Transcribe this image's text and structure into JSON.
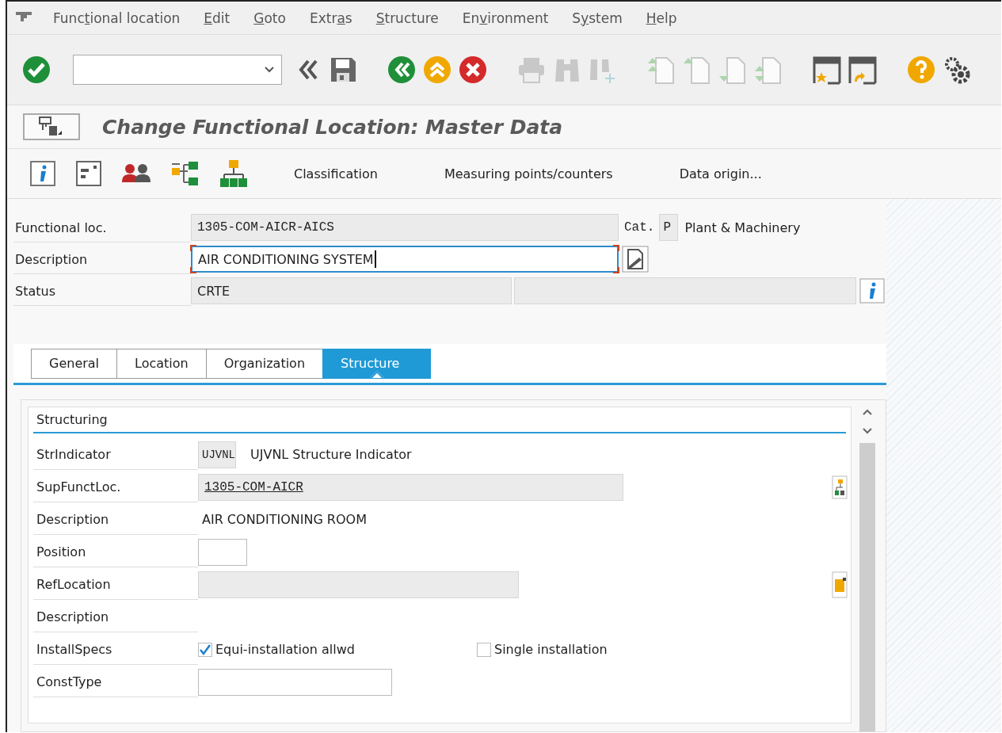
{
  "menu_bar": {
    "items": [
      {
        "before": "Func",
        "mnemonic": "t",
        "after": "ional location"
      },
      {
        "mnemonic": "E",
        "after": "dit"
      },
      {
        "mnemonic": "G",
        "after": "oto"
      },
      {
        "before": "Extr",
        "mnemonic": "a",
        "after": "s"
      },
      {
        "mnemonic": "S",
        "after": "tructure"
      },
      {
        "before": "En",
        "mnemonic": "v",
        "after": "ironment"
      },
      {
        "before": "S",
        "mnemonic": "y",
        "after": "stem"
      },
      {
        "mnemonic": "H",
        "after": "elp"
      }
    ]
  },
  "toolbar": {
    "buttons": [
      {
        "disabled": false
      },
      {
        "disabled": false
      },
      {
        "disabled": false
      },
      {
        "disabled": false
      },
      {
        "disabled": false
      },
      {
        "disabled": false
      },
      {
        "disabled": true
      },
      {
        "disabled": true
      },
      {
        "disabled": true
      },
      {
        "disabled": true
      },
      {
        "disabled": true
      },
      {
        "disabled": true
      },
      {
        "disabled": true
      },
      {
        "disabled": false
      },
      {
        "disabled": false
      },
      {
        "disabled": false
      },
      {
        "disabled": false
      }
    ]
  },
  "title": "Change Functional Location: Master Data",
  "app_toolbar": {
    "text_buttons": [
      "Classification",
      "Measuring points/counters",
      "Data origin..."
    ]
  },
  "header": {
    "rows": [
      {
        "kind": "location",
        "label": "Functional loc.",
        "value": "1305-COM-AICR-AICS",
        "category_label": "Cat.",
        "category_code": "P",
        "category_text": "Plant & Machinery"
      },
      {
        "kind": "description",
        "label": "Description",
        "value": "AIR CONDITIONING SYSTEM",
        "focused": true
      },
      {
        "kind": "status",
        "label": "Status",
        "value": "CRTE"
      }
    ]
  },
  "tabs": [
    {
      "label": "General",
      "selected": false
    },
    {
      "label": "Location",
      "selected": false
    },
    {
      "label": "Organization",
      "selected": false
    },
    {
      "label": "Structure",
      "selected": true
    }
  ],
  "group": {
    "title": "Structuring",
    "rows": [
      {
        "kind": "indicator",
        "label": "StrIndicator",
        "value": "UJVNL",
        "text": "UJVNL Structure Indicator"
      },
      {
        "kind": "link_field",
        "label": "SupFunctLoc.",
        "value": "1305-COM-AICR"
      },
      {
        "kind": "text",
        "label": "Description",
        "value": "AIR CONDITIONING ROOM"
      },
      {
        "kind": "input",
        "label": "Position"
      },
      {
        "kind": "readonly",
        "label": "RefLocation"
      },
      {
        "kind": "empty",
        "label": "Description"
      },
      {
        "kind": "checkboxes",
        "label": "InstallSpecs",
        "options": [
          {
            "label": "Equi-installation allwd",
            "checked": true
          },
          {
            "label": "Single installation",
            "checked": false
          }
        ]
      },
      {
        "kind": "input",
        "label": "ConstType"
      }
    ]
  }
}
